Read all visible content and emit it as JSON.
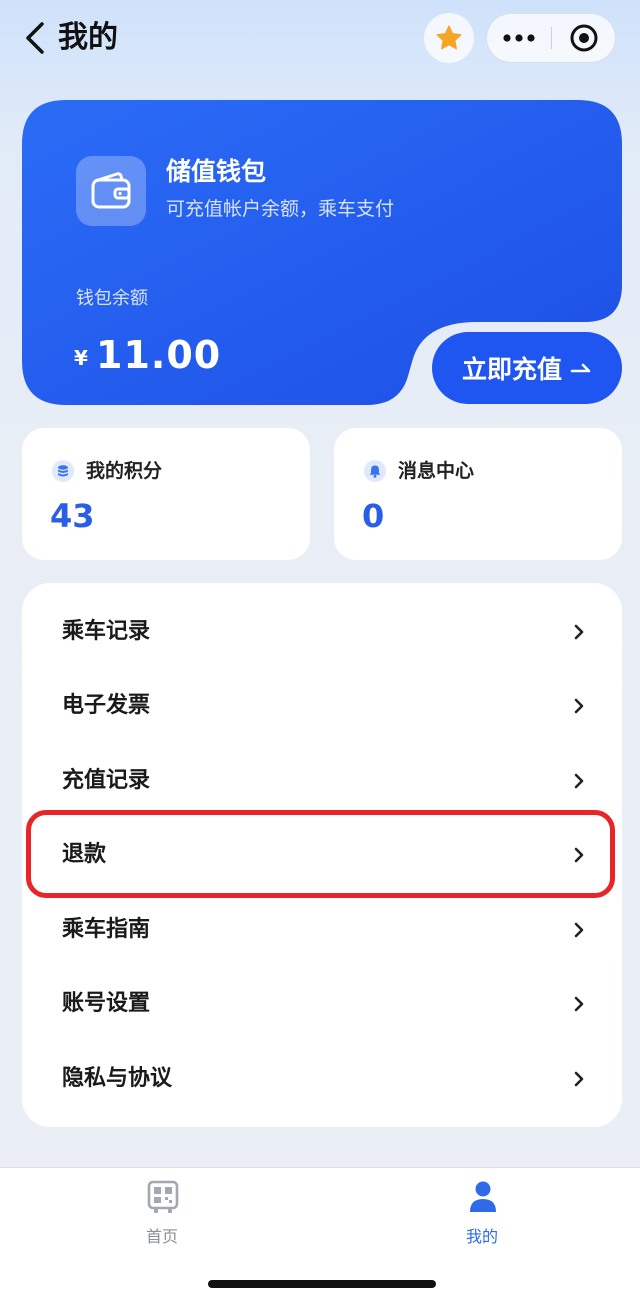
{
  "header": {
    "title": "我的",
    "icons": [
      "back-icon",
      "star-icon",
      "more-icon",
      "target-icon"
    ]
  },
  "wallet": {
    "title": "储值钱包",
    "subtitle": "可充值帐户余额，乘车支付",
    "balance_label": "钱包余额",
    "currency": "¥",
    "balance": "11.00",
    "recharge_label": "立即充值",
    "colors": {
      "card": "#2563f2",
      "button": "#1f55f0"
    }
  },
  "stats": {
    "points": {
      "label": "我的积分",
      "value": "43",
      "icon": "coins-icon"
    },
    "messages": {
      "label": "消息中心",
      "value": "0",
      "icon": "bell-icon"
    }
  },
  "menu": {
    "items": [
      {
        "label": "乘车记录"
      },
      {
        "label": "电子发票"
      },
      {
        "label": "充值记录"
      },
      {
        "label": "退款"
      },
      {
        "label": "乘车指南"
      },
      {
        "label": "账号设置"
      },
      {
        "label": "隐私与协议"
      }
    ],
    "highlight_color": "#e8262a"
  },
  "tabbar": {
    "home_label": "首页",
    "mine_label": "我的",
    "active": "我的",
    "accent": "#2f6be8"
  }
}
